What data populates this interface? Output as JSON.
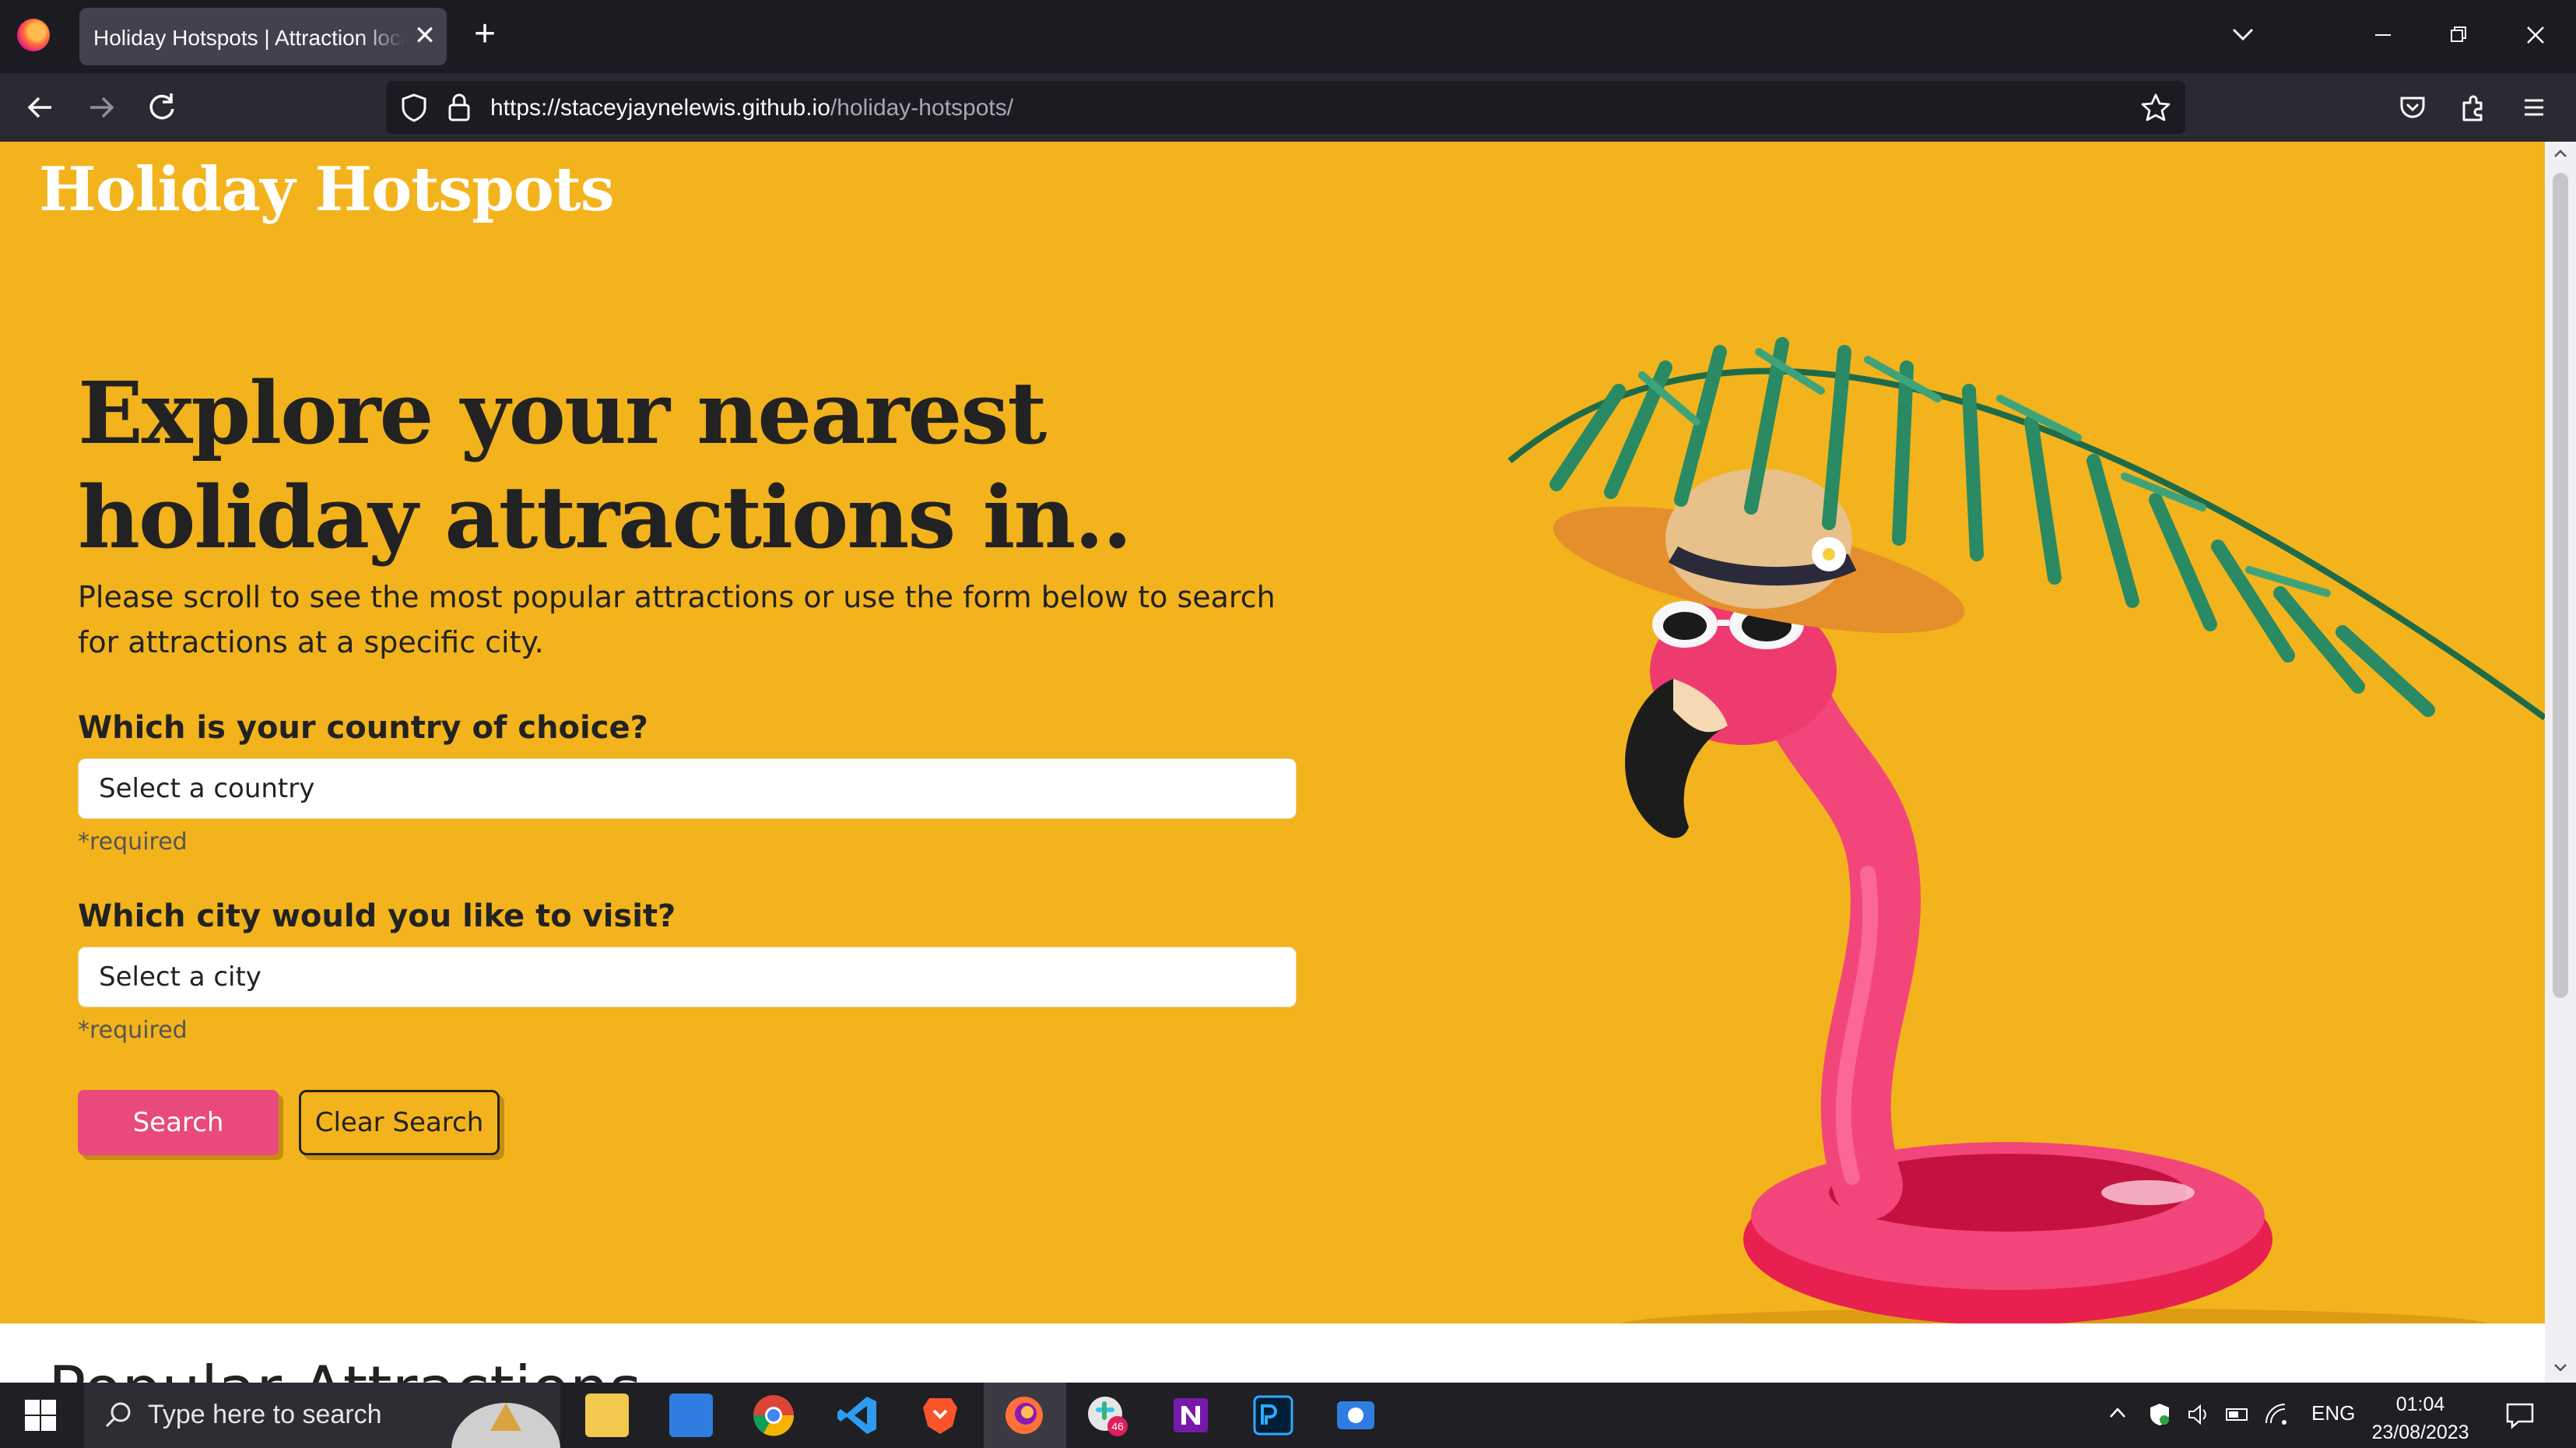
{
  "browser": {
    "tab_title": "Holiday Hotspots | Attraction locator",
    "new_tab_symbol": "+",
    "close_symbol": "✕",
    "url_host": "https://staceyjaynelewis.github.io",
    "url_path": "/holiday-hotspots/"
  },
  "page": {
    "brand": "Holiday Hotspots",
    "headline": "Explore your nearest holiday attractions in..",
    "lead": "Please scroll to see the most popular attractions or use the form below to search for attractions at a specific city.",
    "country_label": "Which is your country of choice?",
    "country_placeholder": "Select a country",
    "city_label": "Which city would you like to visit?",
    "city_placeholder": "Select a city",
    "required_note": "*required",
    "search_button": "Search",
    "clear_button": "Clear Search",
    "section_title": "Popular Attractions",
    "accent_color": "#f3b31c",
    "button_color": "#e94a7b"
  },
  "taskbar": {
    "search_placeholder": "Type here to search",
    "badge_count": "46",
    "language": "ENG",
    "time": "01:04",
    "date": "23/08/2023",
    "apps": [
      "file-explorer-icon",
      "mail-icon",
      "chrome-icon",
      "vscode-icon",
      "brave-icon",
      "firefox-icon",
      "slack-icon",
      "onenote-icon",
      "photoshop-icon",
      "camera-icon"
    ]
  }
}
